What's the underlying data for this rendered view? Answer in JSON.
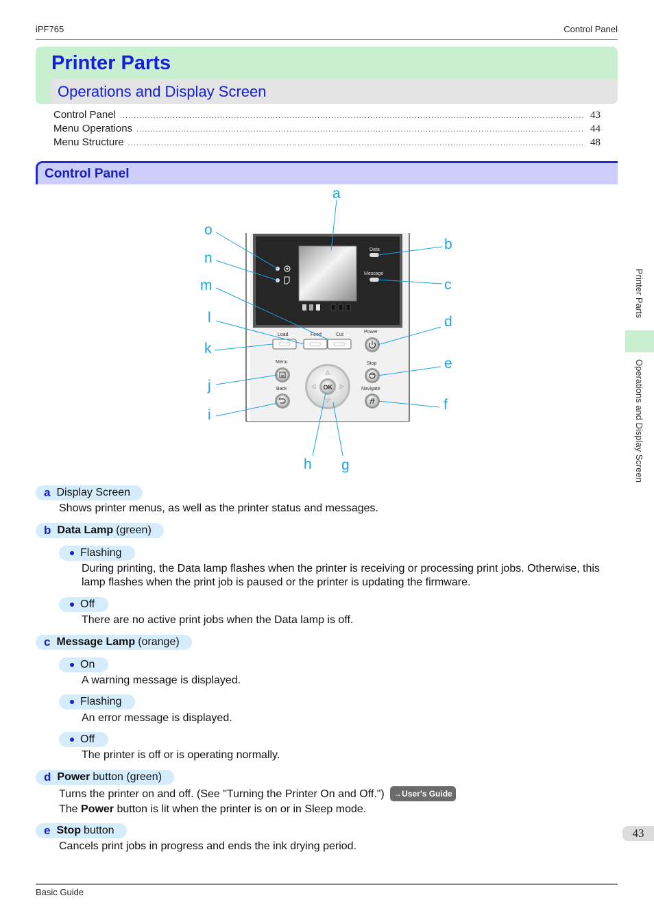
{
  "header": {
    "model": "iPF765",
    "section": "Control Panel"
  },
  "title": {
    "main": "Printer Parts",
    "sub": "Operations and Display Screen"
  },
  "toc": [
    {
      "label": "Control Panel",
      "page": "43"
    },
    {
      "label": "Menu Operations",
      "page": "44"
    },
    {
      "label": "Menu Structure",
      "page": "48"
    }
  ],
  "section_heading": "Control Panel",
  "diagram": {
    "callouts": [
      "a",
      "b",
      "c",
      "d",
      "e",
      "f",
      "g",
      "h",
      "i",
      "j",
      "k",
      "l",
      "m",
      "n",
      "o"
    ],
    "panel_labels": {
      "data": "Data",
      "message": "Message",
      "load": "Load",
      "feed": "Feed",
      "cut": "Cut",
      "power": "Power",
      "menu": "Menu",
      "stop": "Stop",
      "back": "Back",
      "navigate": "Navigate",
      "ok": "OK"
    }
  },
  "items": [
    {
      "letter": "a",
      "title_bold": "",
      "title": "Display Screen",
      "text": "Shows printer menus, as well as the printer status and messages."
    },
    {
      "letter": "b",
      "title_bold": "Data Lamp",
      "title": "(green)",
      "states": [
        {
          "label": "Flashing",
          "text": "During printing, the Data lamp flashes when the printer is receiving or processing print jobs. Otherwise, this lamp flashes when the print job is paused or the printer is updating the firmware."
        },
        {
          "label": "Off",
          "text": "There are no active print jobs when the Data lamp is off."
        }
      ]
    },
    {
      "letter": "c",
      "title_bold": "Message Lamp",
      "title": "(orange)",
      "states": [
        {
          "label": "On",
          "text": "A warning message is displayed."
        },
        {
          "label": "Flashing",
          "text": "An error message is displayed."
        },
        {
          "label": "Off",
          "text": "The printer is off or is operating normally."
        }
      ]
    },
    {
      "letter": "d",
      "title_bold": "Power",
      "title": "button (green)",
      "text1": "Turns the printer on and off.  (See \"Turning the Printer On and Off.\")",
      "link": "→User's Guide",
      "text2_pre": "The ",
      "text2_bold": "Power",
      "text2_post": " button is lit when the printer is on or in Sleep mode."
    },
    {
      "letter": "e",
      "title_bold": "Stop",
      "title": "button",
      "text": "Cancels print jobs in progress and ends the ink drying period."
    }
  ],
  "side_tabs": {
    "chapter": "Printer Parts",
    "section": "Operations and Display Screen"
  },
  "page_number": "43",
  "footer": "Basic Guide",
  "colors": {
    "heading_blue": "#1420d8",
    "title_green": "#c8f0d0",
    "section_lavender": "#cdcdfb",
    "tag_blue": "#d4ecfb",
    "callout_cyan": "#1aa3e0"
  }
}
